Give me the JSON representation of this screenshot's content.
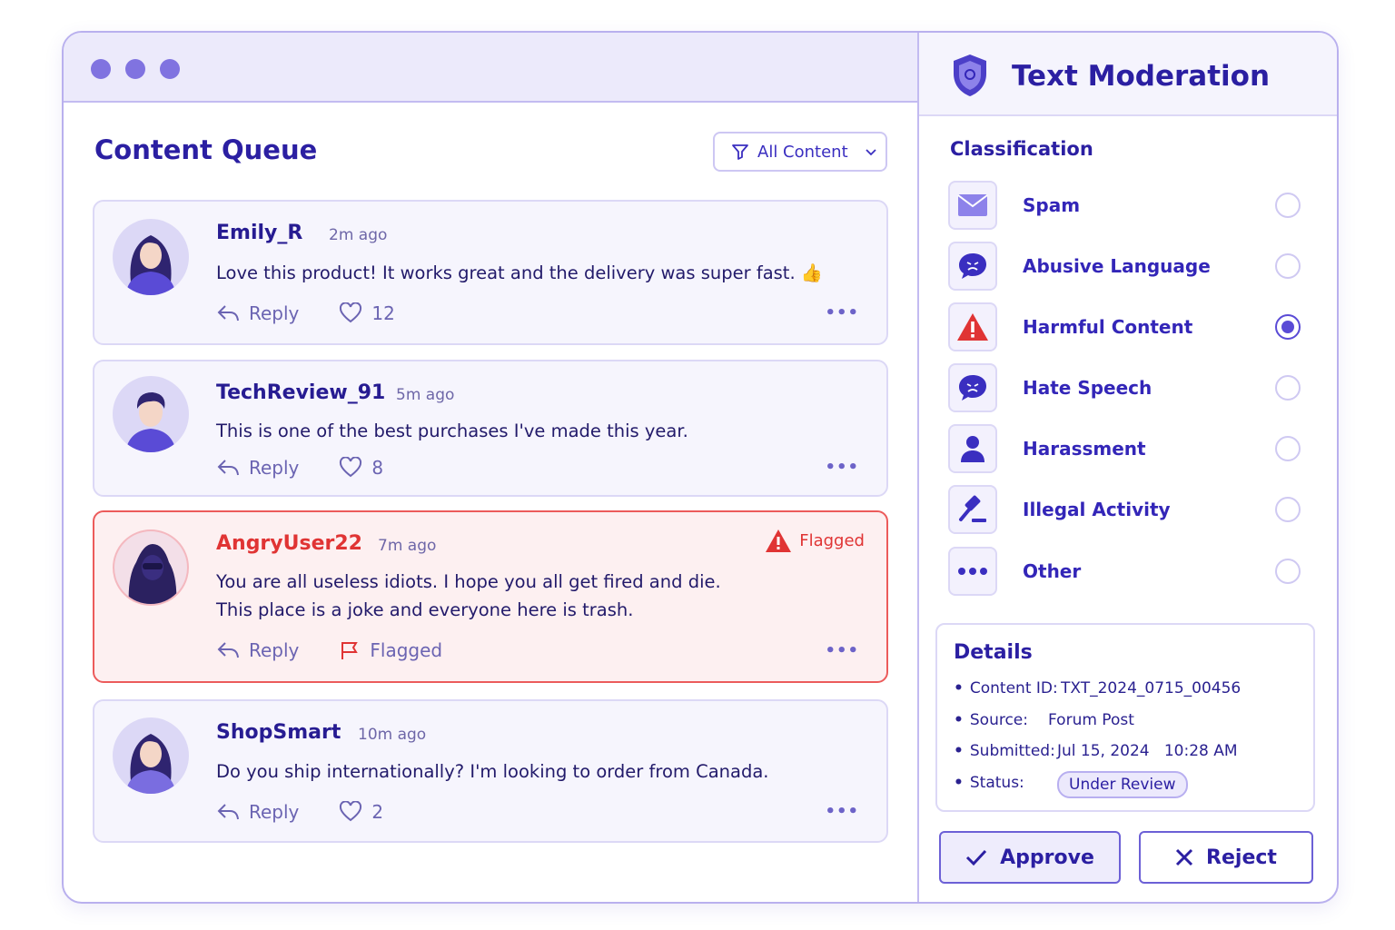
{
  "queue": {
    "title": "Content Queue",
    "filter_label": "All Content",
    "items": [
      {
        "user": "Emily_R",
        "time": "2m ago",
        "lines": [
          "Love this product! It works great and the delivery was super fast. 👍"
        ],
        "reply": "Reply",
        "second_action": "12",
        "second_icon": "heart-icon",
        "flagged": false
      },
      {
        "user": "TechReview_91",
        "time": "5m ago",
        "lines": [
          "This is one of the best purchases I've made this year."
        ],
        "reply": "Reply",
        "second_action": "8",
        "second_icon": "heart-icon",
        "flagged": false
      },
      {
        "user": "AngryUser22",
        "time": "7m ago",
        "lines": [
          "You are all useless idiots. I hope you all get fired and die.",
          "This place is a joke and everyone here is trash."
        ],
        "reply": "Reply",
        "second_action": "Flagged",
        "second_icon": "flag-icon",
        "flagged": true,
        "badge": "Flagged"
      },
      {
        "user": "ShopSmart",
        "time": "10m ago",
        "lines": [
          "Do you ship internationally? I'm looking to order from Canada."
        ],
        "reply": "Reply",
        "second_action": "2",
        "second_icon": "heart-icon",
        "flagged": false
      }
    ]
  },
  "moderation": {
    "title": "Text Moderation",
    "classification_title": "Classification",
    "selected": "Harmful Content",
    "categories": [
      {
        "label": "Spam",
        "icon": "envelope-icon"
      },
      {
        "label": "Abusive Language",
        "icon": "angry-chat-icon"
      },
      {
        "label": "Harmful Content",
        "icon": "warning-icon"
      },
      {
        "label": "Hate Speech",
        "icon": "angry-chat-icon"
      },
      {
        "label": "Harassment",
        "icon": "person-icon"
      },
      {
        "label": "Illegal Activity",
        "icon": "gavel-icon"
      },
      {
        "label": "Other",
        "icon": "more-icon"
      }
    ]
  },
  "details": {
    "title": "Details",
    "content_id_label": "Content ID:",
    "content_id": "TXT_2024_0715_00456",
    "source_label": "Source:",
    "source": "Forum Post",
    "submitted_label": "Submitted:",
    "submitted": "Jul 15, 2024   10:28 AM",
    "status_label": "Status:",
    "status": "Under Review"
  },
  "buttons": {
    "approve": "Approve",
    "reject": "Reject"
  },
  "colors": {
    "accent": "#5a4bd6",
    "flag_red": "#e03434",
    "title": "#2b1fa2"
  }
}
